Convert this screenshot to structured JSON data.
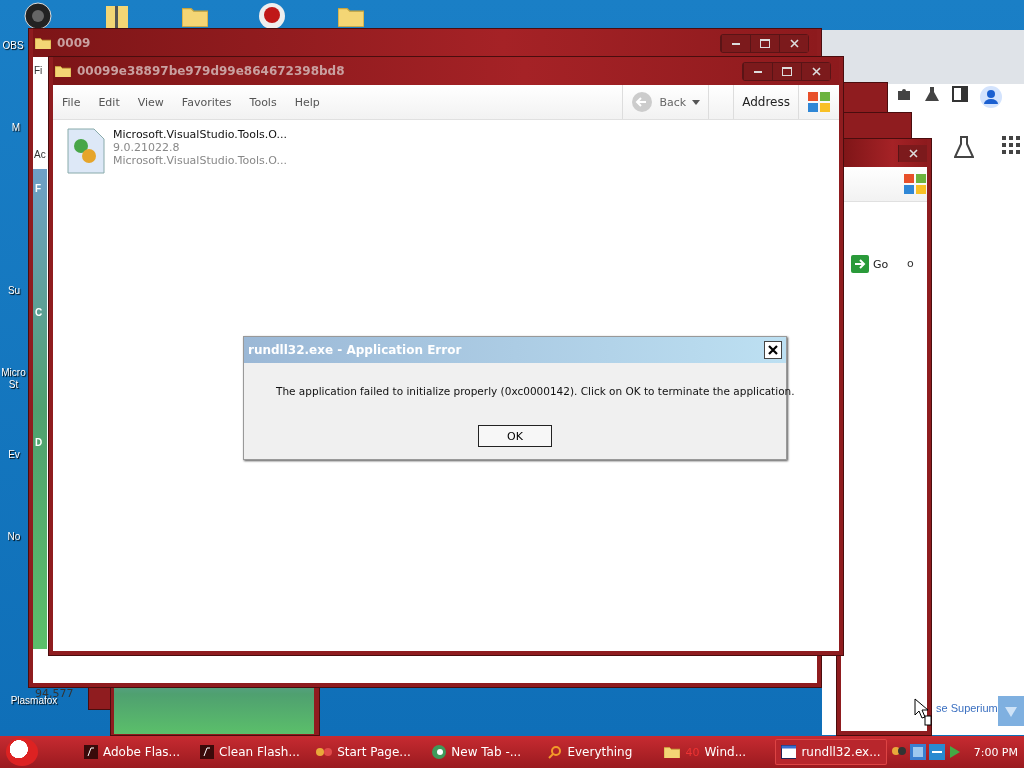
{
  "desktop_icons": [
    {
      "label": "OBS"
    },
    {
      "label": "M"
    },
    {
      "label": "Su"
    },
    {
      "label": "Micro St"
    },
    {
      "label": "Ev"
    },
    {
      "label": "No"
    },
    {
      "label": "Plasmafox"
    }
  ],
  "back_window": {
    "title": "0009",
    "menu_partial": "Fi",
    "address_partial": "Ac",
    "sidebar_letters": [
      "F",
      "C",
      "D"
    ],
    "status": "94,577"
  },
  "explorer": {
    "title": "00099e38897be979d99e864672398bd8",
    "menu": [
      "File",
      "Edit",
      "View",
      "Favorites",
      "Tools",
      "Help"
    ],
    "back": "Back",
    "address": "Address",
    "files": [
      {
        "name": "Microsoft.VisualStudio.Tools.O...",
        "version": "9.0.21022.8",
        "description": "Microsoft.VisualStudio.Tools.O..."
      }
    ]
  },
  "stacked_window": {
    "go": "Go",
    "partial": "o"
  },
  "browser_link": "se Superium",
  "dialog": {
    "title": "rundll32.exe - Application Error",
    "message": "The application failed to initialize properly (0xc0000142). Click on OK to terminate the application.",
    "button": "OK"
  },
  "taskbar": {
    "tasks": [
      {
        "label": "Adobe Flas...",
        "kind": "flash",
        "selected": false
      },
      {
        "label": "Clean Flash...",
        "kind": "flash",
        "selected": false
      },
      {
        "label": "Start Page...",
        "kind": "glasses",
        "selected": false
      },
      {
        "label": "New Tab -...",
        "kind": "globe",
        "selected": false
      },
      {
        "label": "Everything",
        "kind": "search",
        "selected": false
      },
      {
        "label": "Wind...",
        "kind": "folder",
        "badge": "40",
        "selected": false
      },
      {
        "label": "rundll32.ex...",
        "kind": "window",
        "selected": true
      }
    ],
    "clock": "7:00 PM"
  }
}
